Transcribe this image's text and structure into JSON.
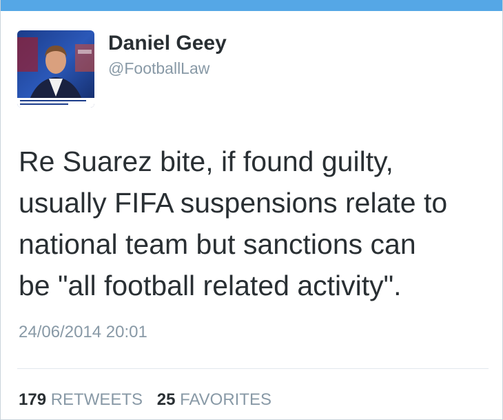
{
  "colors": {
    "accent_bar": "#55a7e6",
    "text_primary": "#292f33",
    "text_secondary": "#8899a6"
  },
  "author": {
    "avatar_icon": "profile-photo",
    "name": "Daniel Geey",
    "handle": "@FootballLaw"
  },
  "tweet": {
    "lines": [
      "Re Suarez bite, if found guilty,",
      "usually FIFA suspensions relate to",
      "national team but sanctions can",
      "be \"all football related activity\"."
    ],
    "timestamp": "24/06/2014 20:01"
  },
  "stats": {
    "retweets_count": "179",
    "retweets_label": "RETWEETS",
    "favorites_count": "25",
    "favorites_label": "FAVORITES"
  }
}
